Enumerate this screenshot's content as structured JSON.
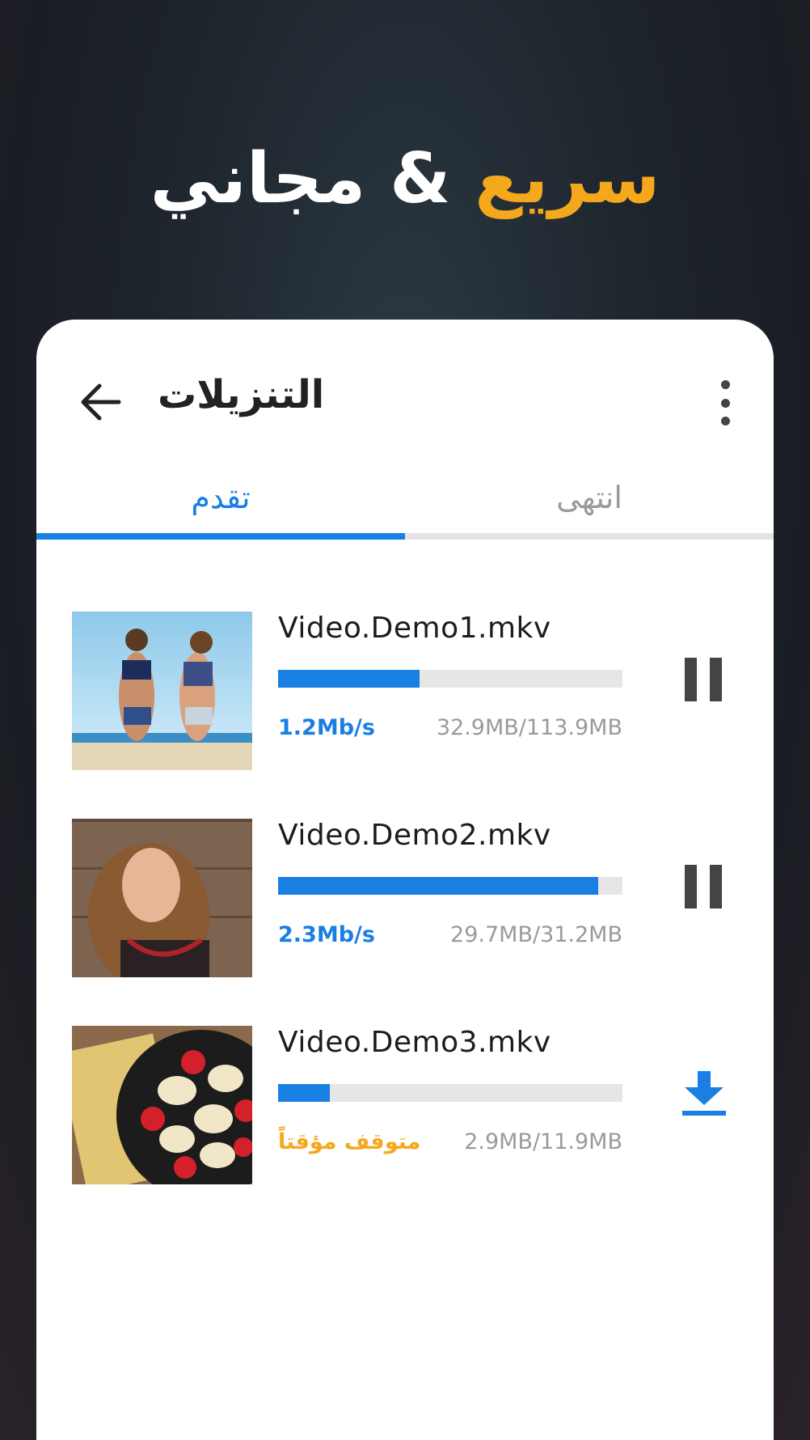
{
  "headline": {
    "accent": "سريع",
    "rest": " & مجاني"
  },
  "toolbar": {
    "title": "التنزيلات"
  },
  "tabs": {
    "progress": "تقدم",
    "done": "انتهى"
  },
  "downloads": [
    {
      "name": "Video.Demo1.mkv",
      "progress": 0.41,
      "status": "1.2Mb/s",
      "size": "32.9MB/113.9MB",
      "action": "pause-icon"
    },
    {
      "name": "Video.Demo2.mkv",
      "progress": 0.93,
      "status": "2.3Mb/s",
      "size": "29.7MB/31.2MB",
      "action": "pause-icon"
    },
    {
      "name": "Video.Demo3.mkv",
      "progress": 0.15,
      "status": "متوقف مؤقتاً",
      "size": "2.9MB/11.9MB",
      "action": "download-icon"
    }
  ],
  "colors": {
    "accent": "#f5a81c",
    "blue": "#1a7fe3"
  }
}
